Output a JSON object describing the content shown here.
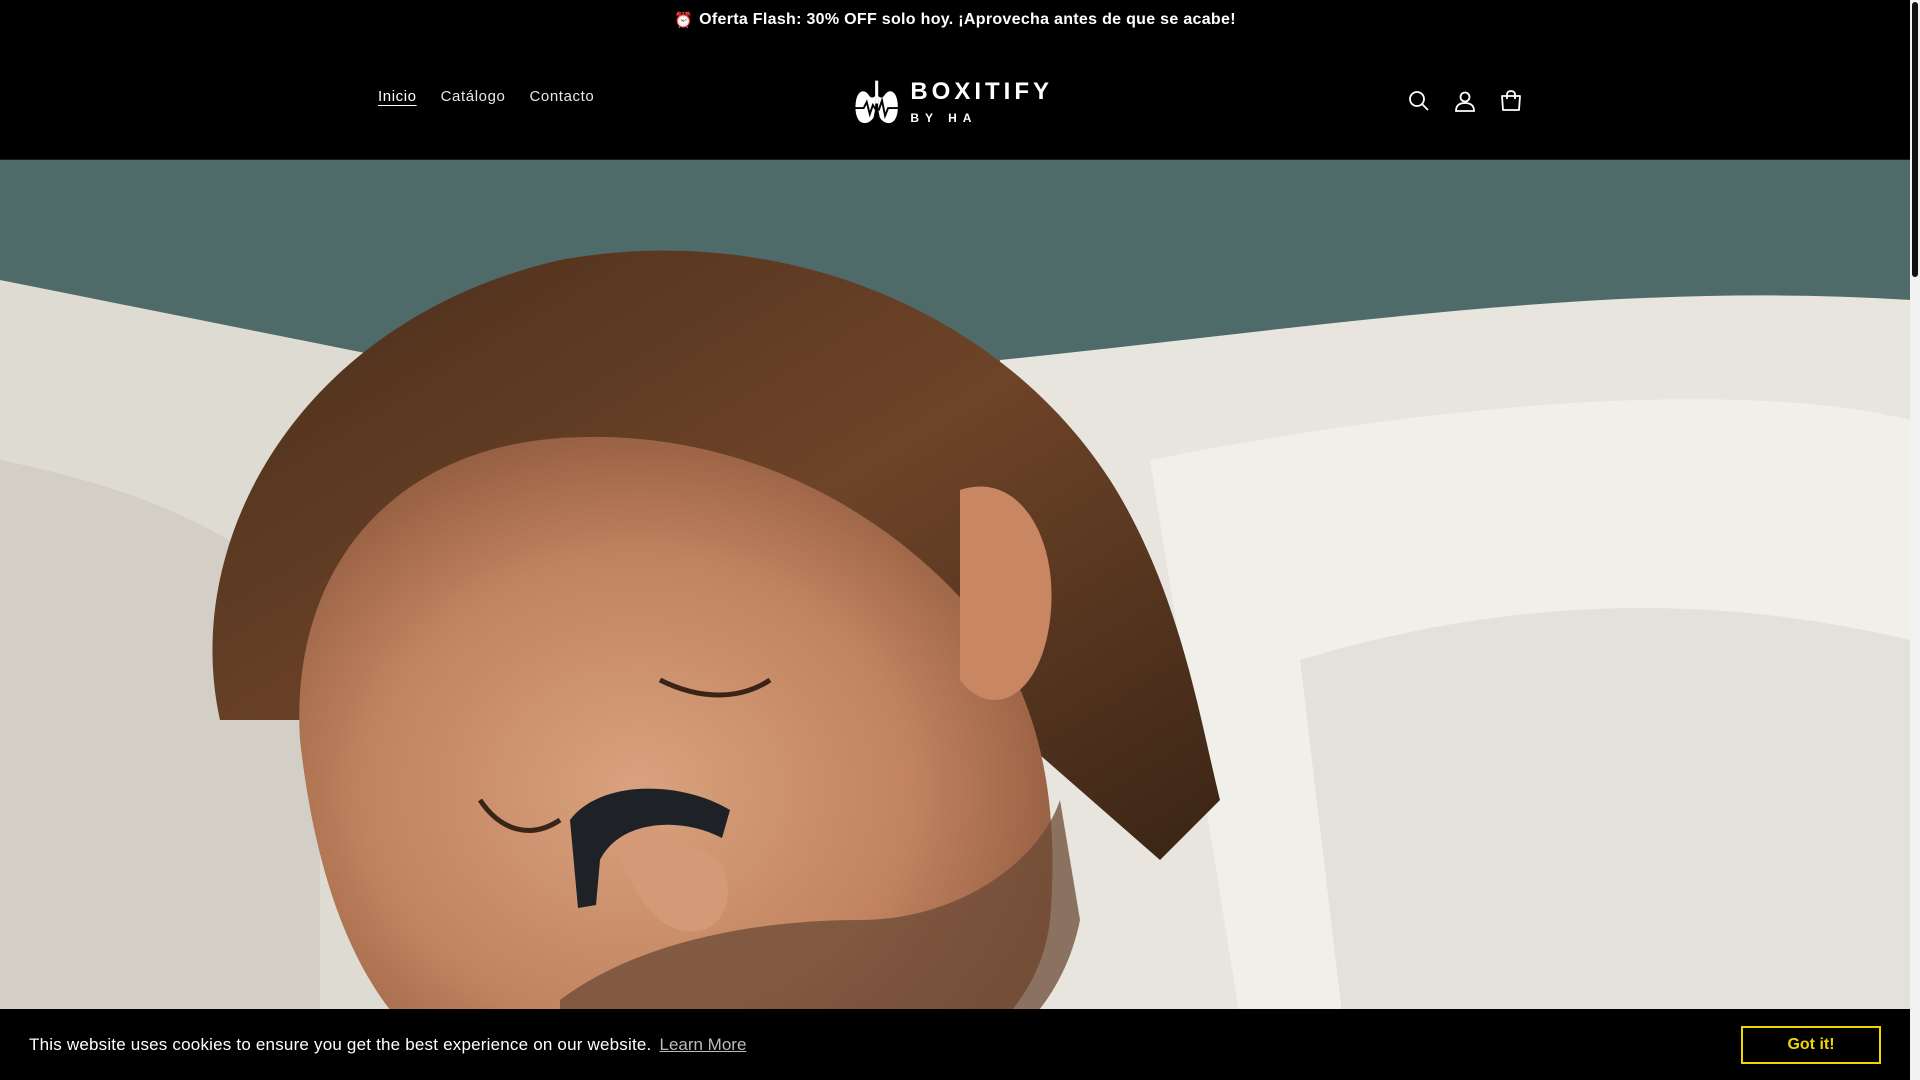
{
  "announcement": {
    "icon": "alarm-clock-icon",
    "clock_glyph": "⏰",
    "text": "Oferta Flash: 30% OFF solo hoy. ¡Aprovecha antes de que se acabe!"
  },
  "nav": {
    "items": [
      {
        "label": "Inicio",
        "active": true
      },
      {
        "label": "Catálogo",
        "active": false
      },
      {
        "label": "Contacto",
        "active": false
      }
    ]
  },
  "logo": {
    "brand": "BOXITIFY",
    "sub": "BY HA",
    "icon": "lungs-heartbeat-icon"
  },
  "header_icons": [
    "search-icon",
    "account-icon",
    "cart-icon"
  ],
  "hero": {
    "image": "man-sleeping-with-nasal-strip"
  },
  "cookie_banner": {
    "message": "This website uses cookies to ensure you get the best experience on our website.",
    "learn_more": "Learn More",
    "accept": "Got it!",
    "accent_color": "#f1d600"
  },
  "colors": {
    "background": "#000000",
    "text": "#ffffff"
  }
}
